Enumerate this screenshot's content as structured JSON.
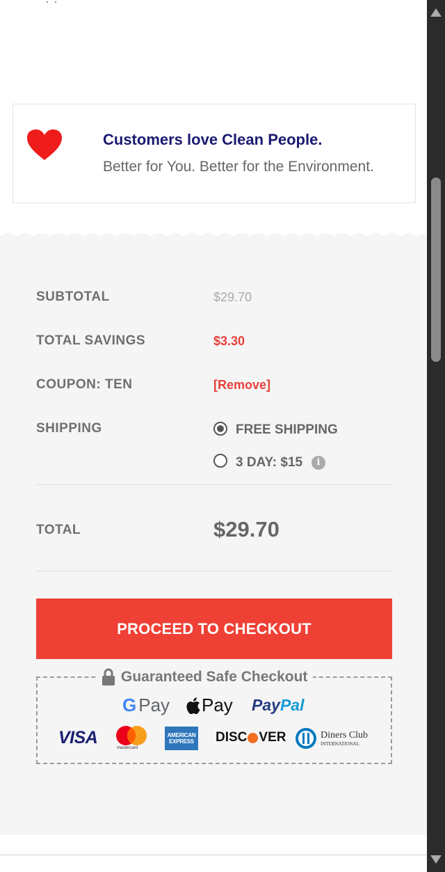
{
  "top_cut_text": "' . .",
  "promo": {
    "title": "Customers love Clean People.",
    "subtitle": "Better for You. Better for the Environment.",
    "icon": "heart-icon",
    "icon_color": "#ef1c1c"
  },
  "summary": {
    "subtotal_label": "SUBTOTAL",
    "subtotal_value": "$29.70",
    "savings_label": "TOTAL SAVINGS",
    "savings_value": "$3.30",
    "coupon_label": "COUPON: TEN",
    "coupon_remove": "[Remove]",
    "shipping_label": "SHIPPING",
    "shipping_options": [
      {
        "label": "FREE SHIPPING",
        "selected": true
      },
      {
        "label": "3 DAY: $15",
        "selected": false
      }
    ],
    "info_icon": "i",
    "total_label": "TOTAL",
    "total_value": "$29.70"
  },
  "checkout": {
    "button_label": "PROCEED TO CHECKOUT",
    "button_color": "#ef4035",
    "safe_title": "Guaranteed Safe Checkout",
    "gpay_g": "G",
    "gpay_text": "Pay",
    "applepay_text": "Pay",
    "paypal_pay": "Pay",
    "paypal_pal": "Pal",
    "visa": "VISA",
    "mastercard_text": "mastercard",
    "amex_line1": "AMERICAN",
    "amex_line2": "EXPRESS",
    "discover_pre": "DISC",
    "discover_post": "VER",
    "diners_line1": "Diners Club",
    "diners_line2": "INTERNATIONAL"
  },
  "colors": {
    "accent": "#ef4035",
    "title_navy": "#1b1a70",
    "background_grey": "#f5f5f5"
  }
}
